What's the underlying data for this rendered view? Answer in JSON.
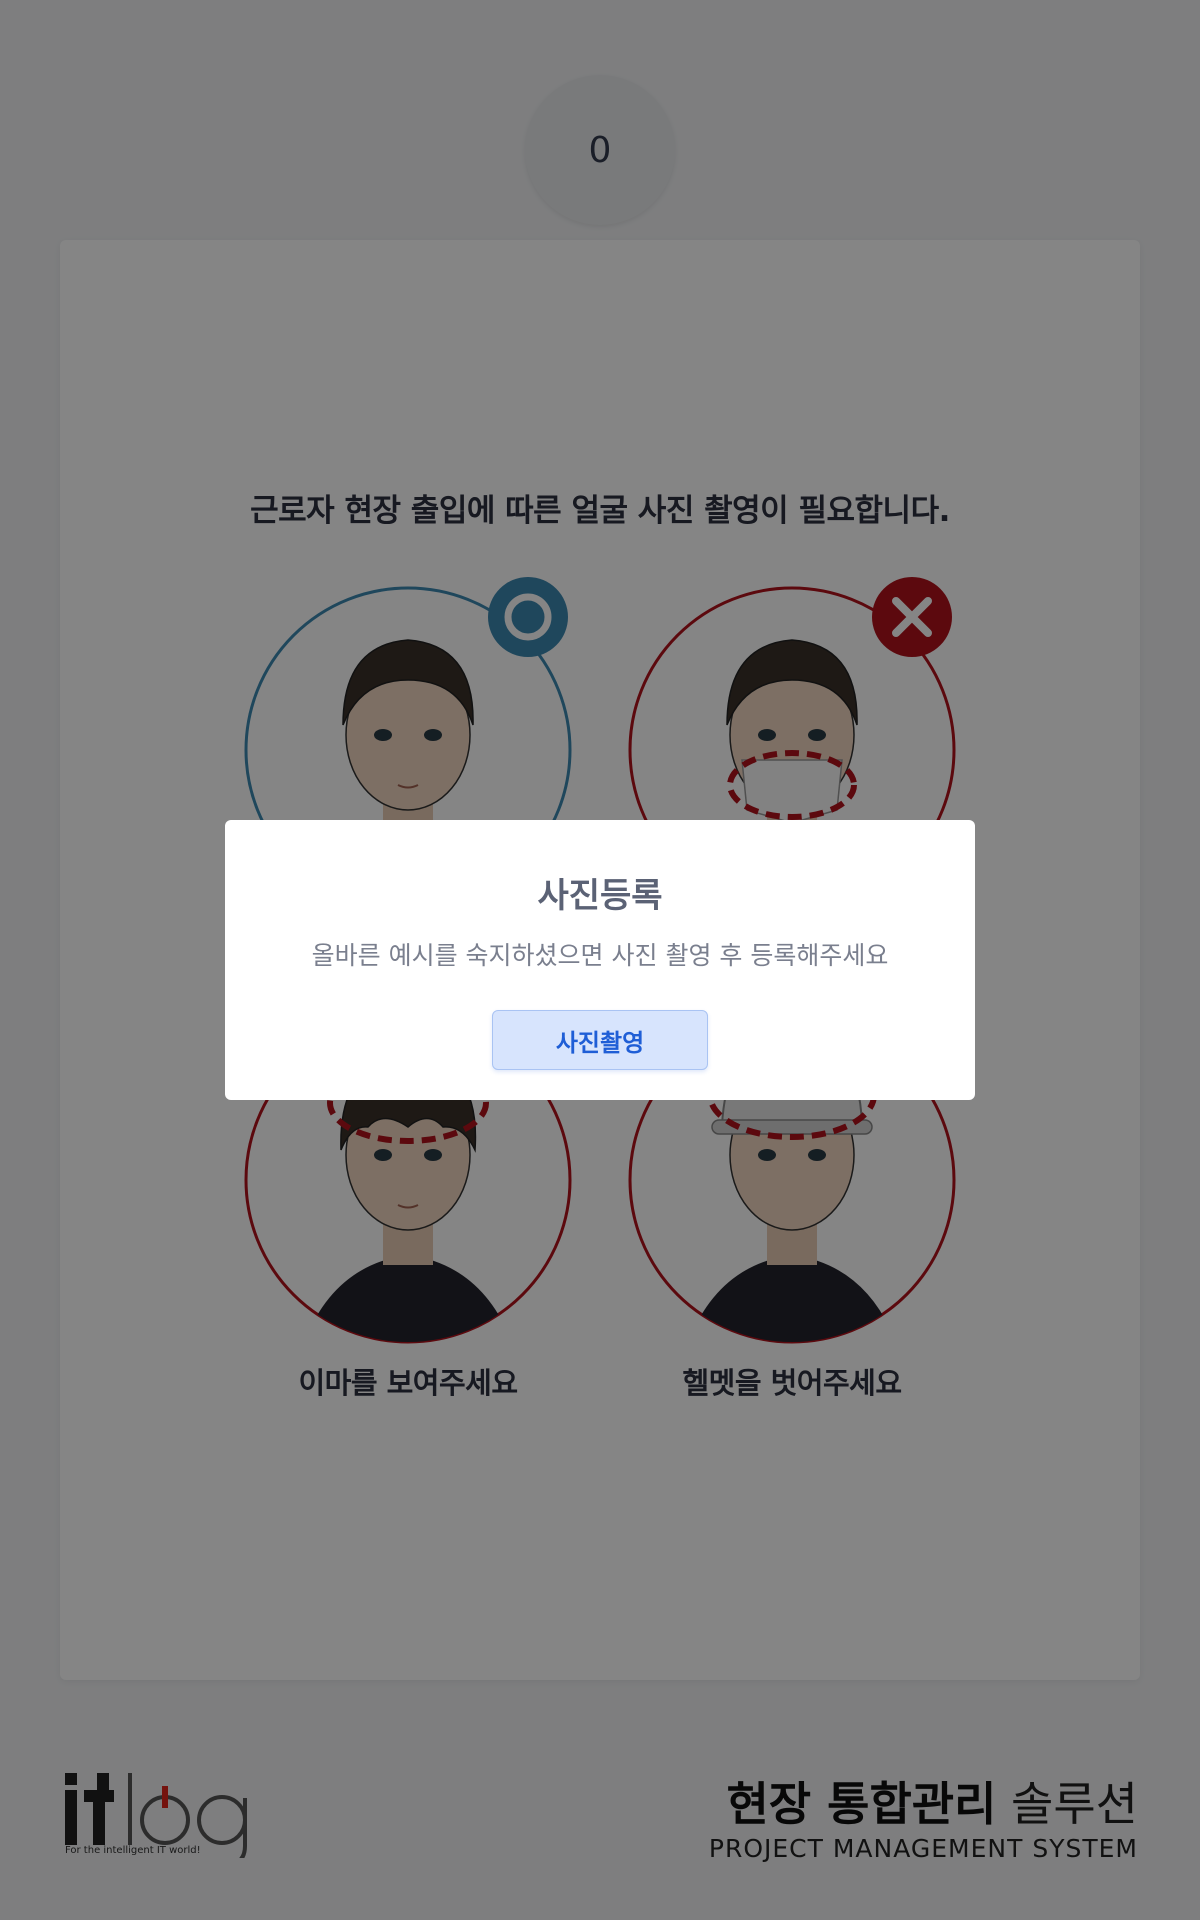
{
  "step": {
    "number": "0"
  },
  "guide": {
    "heading": "근로자 현장 출입에 따른 얼굴 사진 촬영이 필요합니다.",
    "examples": [
      {
        "kind": "correct",
        "badge": "circle-o-icon",
        "label": ""
      },
      {
        "kind": "wrong-mask",
        "badge": "x-icon",
        "label": ""
      },
      {
        "kind": "wrong-hair",
        "badge": "x-icon",
        "label": "이마를 보여주세요"
      },
      {
        "kind": "wrong-helmet",
        "badge": "x-icon",
        "label": "헬멧을 벗어주세요"
      }
    ]
  },
  "footer": {
    "logo_text": "itlog",
    "logo_tagline": "For the intelligent IT world!",
    "solution_title_bold": "현장 통합관리",
    "solution_title_light": "솔루션",
    "solution_subtitle": "PROJECT MANAGEMENT SYSTEM"
  },
  "modal": {
    "title": "사진등록",
    "message": "올바른 예시를 숙지하셨으면 사진 촬영 후 등록해주세요",
    "button_label": "사진촬영"
  },
  "colors": {
    "correct": "#3d88b0",
    "wrong": "#b0121b",
    "accent_blue": "#1f5ed6"
  }
}
